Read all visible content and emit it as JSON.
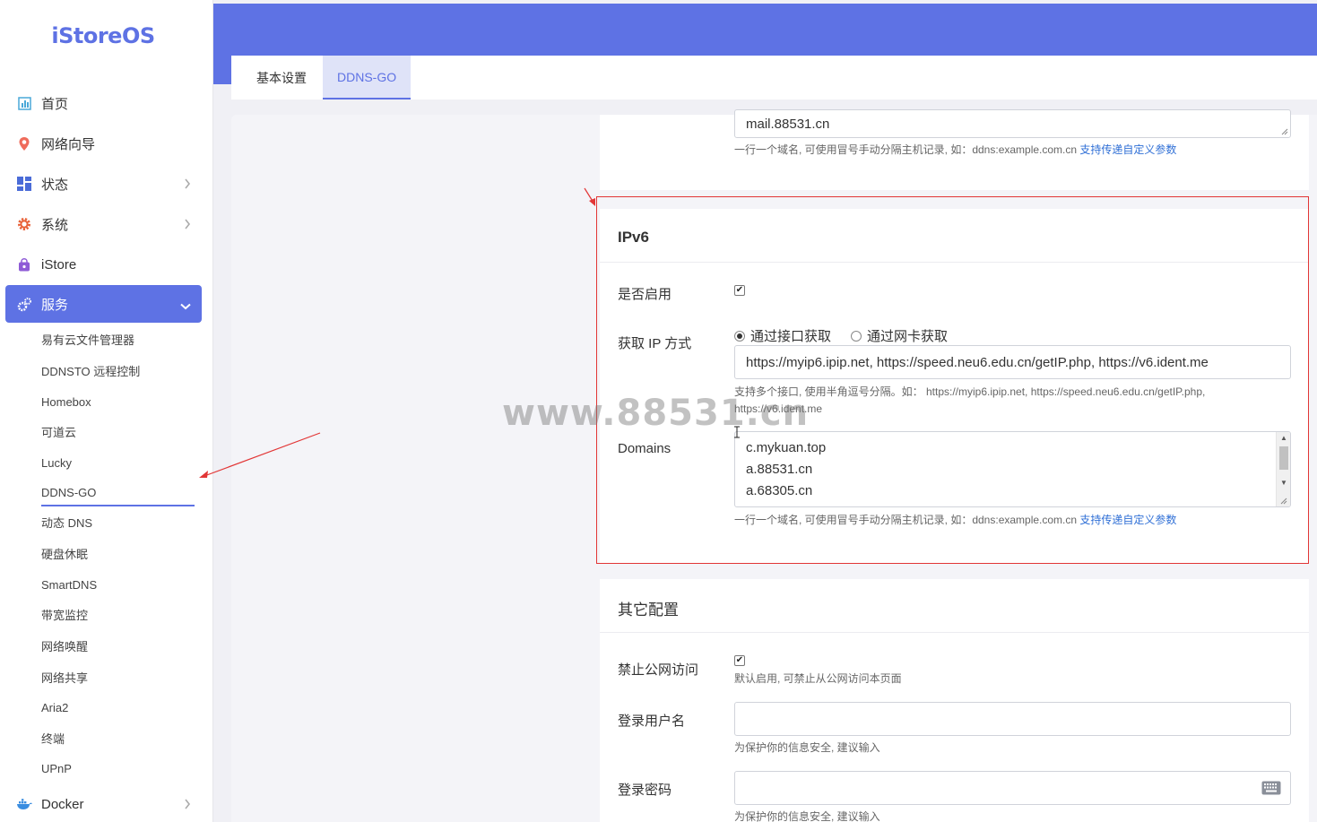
{
  "brand": {
    "logo": "iStoreOS",
    "accent": "#5e72e4"
  },
  "sidebar": {
    "items": [
      {
        "label": "首页",
        "icon": "dashboard-icon"
      },
      {
        "label": "网络向导",
        "icon": "location-pin-icon"
      },
      {
        "label": "状态",
        "icon": "grid-icon"
      },
      {
        "label": "系统",
        "icon": "gear-icon"
      },
      {
        "label": "iStore",
        "icon": "store-bag-icon"
      },
      {
        "label": "服务",
        "icon": "services-gear-icon",
        "active": true
      },
      {
        "label": "Docker",
        "icon": "docker-whale-icon"
      }
    ],
    "sub_items": [
      "易有云文件管理器",
      "DDNSTO 远程控制",
      "Homebox",
      "可道云",
      "Lucky",
      "DDNS-GO",
      "动态 DNS",
      "硬盘休眠",
      "SmartDNS",
      "带宽监控",
      "网络唤醒",
      "网络共享",
      "Aria2",
      "终端",
      "UPnP"
    ],
    "active_sub": "DDNS-GO"
  },
  "tabs": [
    {
      "label": "基本设置",
      "active": false
    },
    {
      "label": "DDNS-GO",
      "active": true
    }
  ],
  "prev_section": {
    "domains_tail": "mail.88531.cn",
    "hint": "一行一个域名, 可使用冒号手动分隔主机记录, 如：ddns:example.com.cn",
    "hint_link": "支持传递自定义参数"
  },
  "ipv6": {
    "title": "IPv6",
    "enable_label": "是否启用",
    "enable_checked": true,
    "ip_method_label": "获取 IP 方式",
    "ip_method_options": [
      "通过接口获取",
      "通过网卡获取"
    ],
    "ip_method_selected": "通过接口获取",
    "ip_url_value": "https://myip6.ipip.net, https://speed.neu6.edu.cn/getIP.php, https://v6.ident.me",
    "ip_url_hint_line1": "支持多个接口, 使用半角逗号分隔。如： https://myip6.ipip.net, https://speed.neu6.edu.cn/getIP.php,",
    "ip_url_hint_line2": "https://v6.ident.me",
    "domains_label": "Domains",
    "domains": [
      "c.mykuan.top",
      "a.88531.cn",
      "a.68305.cn"
    ],
    "domains_hint": "一行一个域名, 可使用冒号手动分隔主机记录, 如：ddns:example.com.cn",
    "domains_hint_link": "支持传递自定义参数"
  },
  "other": {
    "title": "其它配置",
    "block_public_label": "禁止公网访问",
    "block_public_checked": true,
    "block_public_hint": "默认启用, 可禁止从公网访问本页面",
    "username_label": "登录用户名",
    "username_value": "",
    "username_hint": "为保护你的信息安全, 建议输入",
    "password_label": "登录密码",
    "password_value": "",
    "password_hint": "为保护你的信息安全, 建议输入"
  },
  "watermark": "www.88531.cn",
  "annotation_color": "#e23636"
}
